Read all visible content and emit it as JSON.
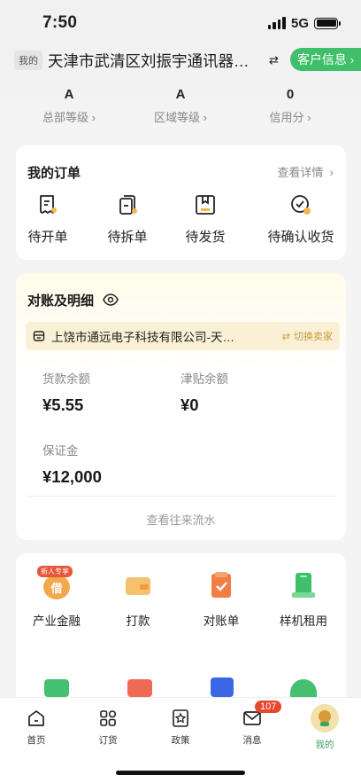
{
  "status_bar": {
    "time": "7:50",
    "network": "5G"
  },
  "header": {
    "mine_tag": "我的",
    "store_name": "天津市武清区刘振宇通讯器材…",
    "customer_info_label": "客户信息"
  },
  "levels": [
    {
      "value": "A",
      "label": "总部等级"
    },
    {
      "value": "A",
      "label": "区域等级"
    },
    {
      "value": "0",
      "label": "信用分"
    }
  ],
  "orders": {
    "title": "我的订单",
    "detail_link": "查看详情",
    "items": [
      {
        "label": "待开单",
        "icon": "invoice-icon"
      },
      {
        "label": "待拆单",
        "icon": "split-icon"
      },
      {
        "label": "待发货",
        "icon": "box-icon"
      },
      {
        "label": "待确认收货",
        "icon": "check-clock-icon"
      }
    ]
  },
  "reconciliation": {
    "title": "对账及明细",
    "company": "上饶市通远电子科技有限公司-天津…",
    "switch_seller": "切换卖家",
    "goods_balance_label": "货款余额",
    "goods_balance_value": "¥5.55",
    "subsidy_balance_label": "津贴余额",
    "subsidy_balance_value": "¥0",
    "deposit_label": "保证金",
    "deposit_value": "¥12,000",
    "history_link": "查看往来流水"
  },
  "tools": {
    "items": [
      {
        "label": "产业金融",
        "icon": "finance-icon",
        "tag": "新人专享",
        "glyph": "借"
      },
      {
        "label": "打款",
        "icon": "card-icon"
      },
      {
        "label": "对账单",
        "icon": "statement-icon"
      },
      {
        "label": "样机租用",
        "icon": "phone-rent-icon"
      }
    ]
  },
  "bottom_nav": {
    "items": [
      {
        "label": "首页",
        "icon": "home-icon"
      },
      {
        "label": "订货",
        "icon": "grid-icon"
      },
      {
        "label": "政策",
        "icon": "star-badge-icon"
      },
      {
        "label": "消息",
        "icon": "mail-icon",
        "badge": "107"
      },
      {
        "label": "我的",
        "icon": "avatar-icon"
      }
    ]
  },
  "colors": {
    "brand_green": "#3fbf6a",
    "badge_red": "#e6482f",
    "gold": "#c99a3c"
  }
}
